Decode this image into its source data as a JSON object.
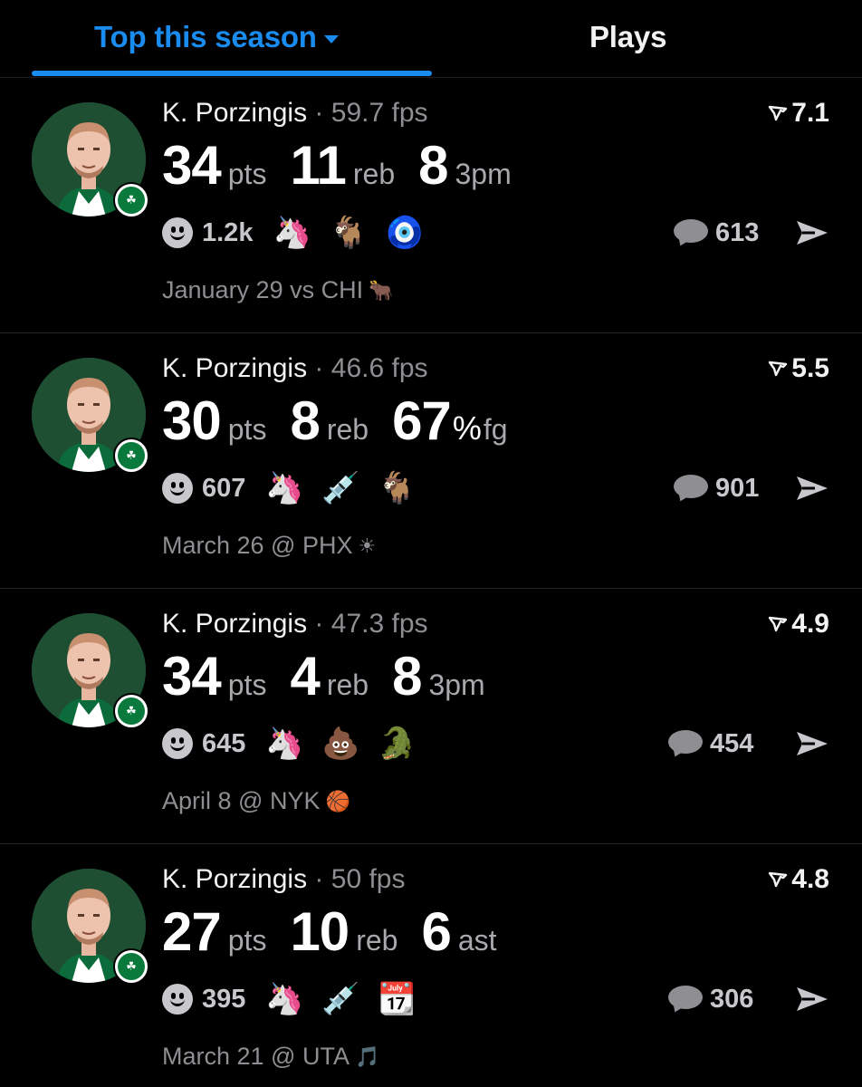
{
  "tabs": {
    "active_label": "Top this season",
    "other_label": "Plays"
  },
  "colors": {
    "accent": "#1a8cf0",
    "background": "#000000",
    "muted": "#8e8e93"
  },
  "cards": [
    {
      "name": "K. Porzingis",
      "sep": "·",
      "fps": "59.7 fps",
      "rating": "7.1",
      "stats": [
        {
          "num": "34",
          "unit": "pts"
        },
        {
          "num": "11",
          "unit": "reb"
        },
        {
          "num": "8",
          "unit": "3pm"
        }
      ],
      "reaction_count": "1.2k",
      "emojis": [
        "🦄",
        "🐐",
        "🧿"
      ],
      "comments": "613",
      "date": "January 29 vs CHI",
      "team_logo": "🐂"
    },
    {
      "name": "K. Porzingis",
      "sep": "·",
      "fps": "46.6 fps",
      "rating": "5.5",
      "stats": [
        {
          "num": "30",
          "unit": "pts"
        },
        {
          "num": "8",
          "unit": "reb"
        },
        {
          "num": "67",
          "pct": "%",
          "unit": "fg"
        }
      ],
      "reaction_count": "607",
      "emojis": [
        "🦄",
        "💉",
        "🐐"
      ],
      "comments": "901",
      "date": "March 26 @ PHX",
      "team_logo": "☀"
    },
    {
      "name": "K. Porzingis",
      "sep": "·",
      "fps": "47.3 fps",
      "rating": "4.9",
      "stats": [
        {
          "num": "34",
          "unit": "pts"
        },
        {
          "num": "4",
          "unit": "reb"
        },
        {
          "num": "8",
          "unit": "3pm"
        }
      ],
      "reaction_count": "645",
      "emojis": [
        "🦄",
        "💩",
        "🐊"
      ],
      "comments": "454",
      "date": "April 8 @ NYK",
      "team_logo": "🏀"
    },
    {
      "name": "K. Porzingis",
      "sep": "·",
      "fps": "50 fps",
      "rating": "4.8",
      "stats": [
        {
          "num": "27",
          "unit": "pts"
        },
        {
          "num": "10",
          "unit": "reb"
        },
        {
          "num": "6",
          "unit": "ast"
        }
      ],
      "reaction_count": "395",
      "emojis": [
        "🦄",
        "💉",
        "📆"
      ],
      "comments": "306",
      "date": "March 21 @ UTA",
      "team_logo": "🎵"
    }
  ],
  "icons": {
    "avatar": "player-headshot",
    "badge": "celtics-logo-icon",
    "rating": "rating-icon",
    "reaction": "smiley-icon",
    "comment": "comment-bubble-icon",
    "share": "share-arrow-icon",
    "badge_text": "☘"
  }
}
